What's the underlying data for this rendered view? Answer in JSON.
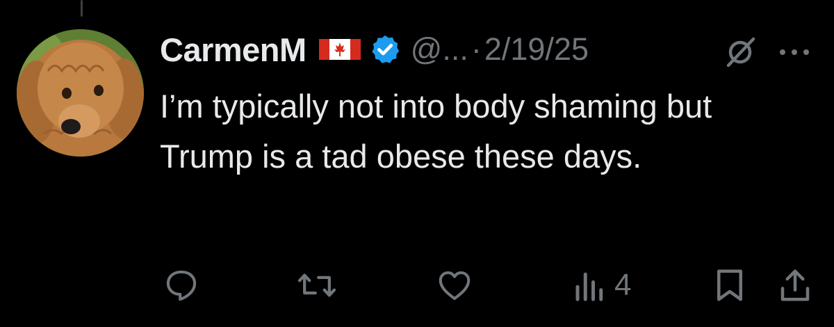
{
  "tweet": {
    "display_name": "CarmenM",
    "handle": "@...",
    "separator": "·",
    "timestamp": "2/19/25",
    "text": "I’m typically not into body shaming but Trump is a tad obese these days.",
    "flag_icon": "canada-flag-icon",
    "verified_icon": "verified-badge-icon",
    "avatar_icon": "dog-avatar"
  },
  "actions": {
    "reply_icon": "reply-icon",
    "retweet_icon": "retweet-icon",
    "like_icon": "heart-icon",
    "views_icon": "views-chart-icon",
    "views_count": "4",
    "bookmark_icon": "bookmark-icon",
    "share_icon": "share-icon"
  },
  "colors": {
    "background": "#000000",
    "primary_text": "#e7e9ea",
    "secondary_text": "#71767b",
    "verified_blue": "#1d9bf0",
    "flag_red": "#d52b1e"
  }
}
